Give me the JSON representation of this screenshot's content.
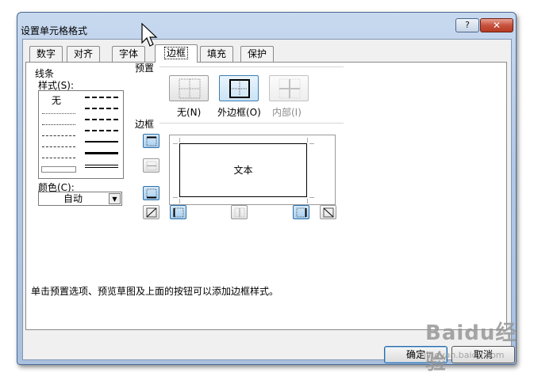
{
  "window": {
    "title": "设置单元格格式",
    "help_label": "?",
    "close_label": "✕"
  },
  "tabs": [
    {
      "label": "数字"
    },
    {
      "label": "对齐"
    },
    {
      "label": "字体"
    },
    {
      "label": "边框",
      "active": true
    },
    {
      "label": "填充"
    },
    {
      "label": "保护"
    }
  ],
  "line_group": {
    "title": "线条",
    "style_label": "样式(S):",
    "none_option": "无",
    "color_label": "颜色(C):",
    "color_value": "自动"
  },
  "presets": {
    "title": "预置",
    "items": [
      {
        "label": "无(N)"
      },
      {
        "label": "外边框(O)",
        "selected": true
      },
      {
        "label": "内部(I)",
        "disabled": true
      }
    ]
  },
  "border": {
    "title": "边框",
    "preview_text": "文本"
  },
  "hint": "单击预置选项、预览草图及上面的按钮可以添加边框样式。",
  "buttons": {
    "ok": "确定",
    "cancel": "取消"
  },
  "watermark": {
    "line1": "Baidu经验",
    "line2": "jingyan.baidu.com"
  },
  "colors": {
    "title_bar": "#b3c9e6",
    "close_button": "#c7523e",
    "selected_button": "#a8cff0"
  }
}
